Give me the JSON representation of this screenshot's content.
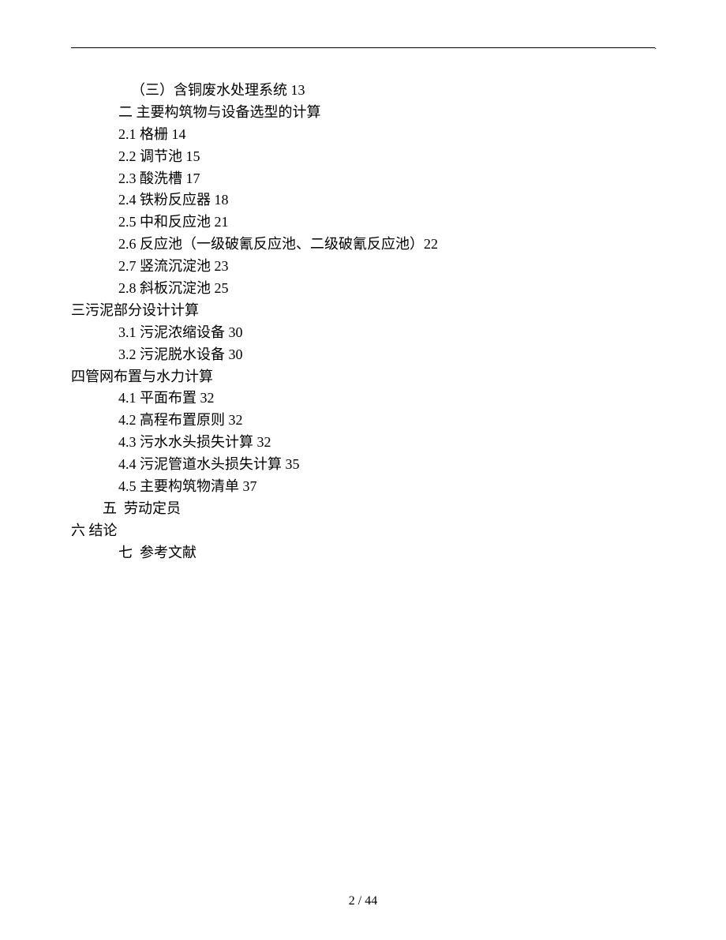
{
  "toc": {
    "lines": [
      {
        "indent": 3,
        "text": "（三）含铜废水处理系统 13"
      },
      {
        "indent": 2,
        "text": "二 主要构筑物与设备选型的计算"
      },
      {
        "indent": 2,
        "text": "2.1 格栅 14"
      },
      {
        "indent": 2,
        "text": "2.2 调节池 15"
      },
      {
        "indent": 2,
        "text": "2.3 酸洗槽 17"
      },
      {
        "indent": 2,
        "text": "2.4 铁粉反应器 18"
      },
      {
        "indent": 2,
        "text": "2.5 中和反应池 21"
      },
      {
        "indent": 2,
        "text": "2.6 反应池（一级破氰反应池、二级破氰反应池）22"
      },
      {
        "indent": 2,
        "text": "2.7 竖流沉淀池 23"
      },
      {
        "indent": 2,
        "text": "2.8 斜板沉淀池 25"
      },
      {
        "indent": 0,
        "text": "三污泥部分设计计算"
      },
      {
        "indent": 2,
        "text": "3.1 污泥浓缩设备 30"
      },
      {
        "indent": 2,
        "text": "3.2 污泥脱水设备 30"
      },
      {
        "indent": 0,
        "text": "四管网布置与水力计算"
      },
      {
        "indent": 2,
        "text": "4.1 平面布置 32"
      },
      {
        "indent": 2,
        "text": "4.2 高程布置原则 32"
      },
      {
        "indent": 2,
        "text": "4.3 污水水头损失计算 32"
      },
      {
        "indent": 2,
        "text": "4.4 污泥管道水头损失计算 35"
      },
      {
        "indent": 2,
        "text": "4.5 主要构筑物清单 37"
      },
      {
        "indent": 1,
        "text": "五  劳动定员"
      },
      {
        "indent": 0,
        "text": "六 结论"
      },
      {
        "indent": 2,
        "text": "七  参考文献"
      }
    ]
  },
  "footer": {
    "page_number": "2 / 44"
  }
}
